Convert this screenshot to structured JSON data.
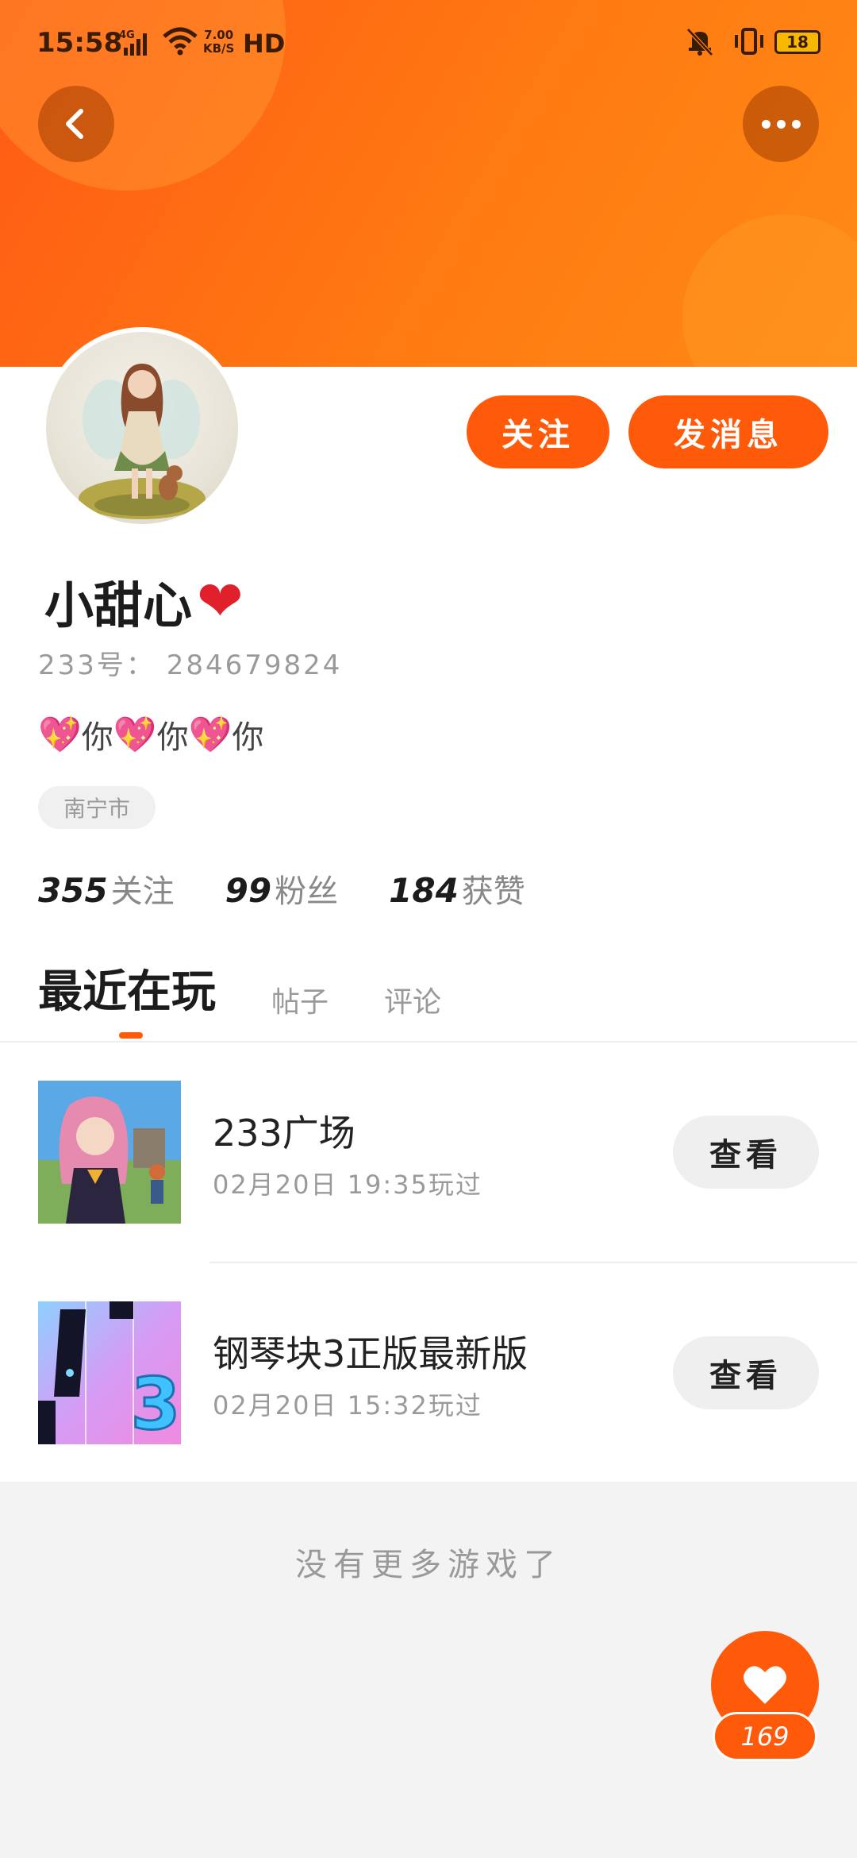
{
  "status_bar": {
    "time": "15:58",
    "network": "4G",
    "speed_top": "7.00",
    "speed_bottom": "KB/S",
    "hd": "HD",
    "battery": "18"
  },
  "header": {
    "back_icon": "chevron-left-icon",
    "more_icon": "more-horizontal-icon",
    "accent_color": "#ff5a0a"
  },
  "profile": {
    "nickname": "小甜心",
    "nickname_emoji": "❤",
    "uid": "233号： 284679824",
    "bio": [
      "你",
      "你",
      "你"
    ],
    "location": "南宁市",
    "follow_label": "关注",
    "message_label": "发消息"
  },
  "stats": [
    {
      "value": "355",
      "label": "关注"
    },
    {
      "value": "99",
      "label": "粉丝"
    },
    {
      "value": "184",
      "label": "获赞"
    }
  ],
  "tabs": [
    {
      "label": "最近在玩",
      "active": true
    },
    {
      "label": "帖子",
      "active": false
    },
    {
      "label": "评论",
      "active": false
    }
  ],
  "games": [
    {
      "title": "233广场",
      "time": "02月20日 19:35玩过",
      "action": "查看"
    },
    {
      "title": "钢琴块3正版最新版",
      "time": "02月20日 15:32玩过",
      "action": "查看"
    }
  ],
  "footer_text": "没有更多游戏了",
  "like": {
    "count": "169",
    "icon": "heart-icon"
  }
}
